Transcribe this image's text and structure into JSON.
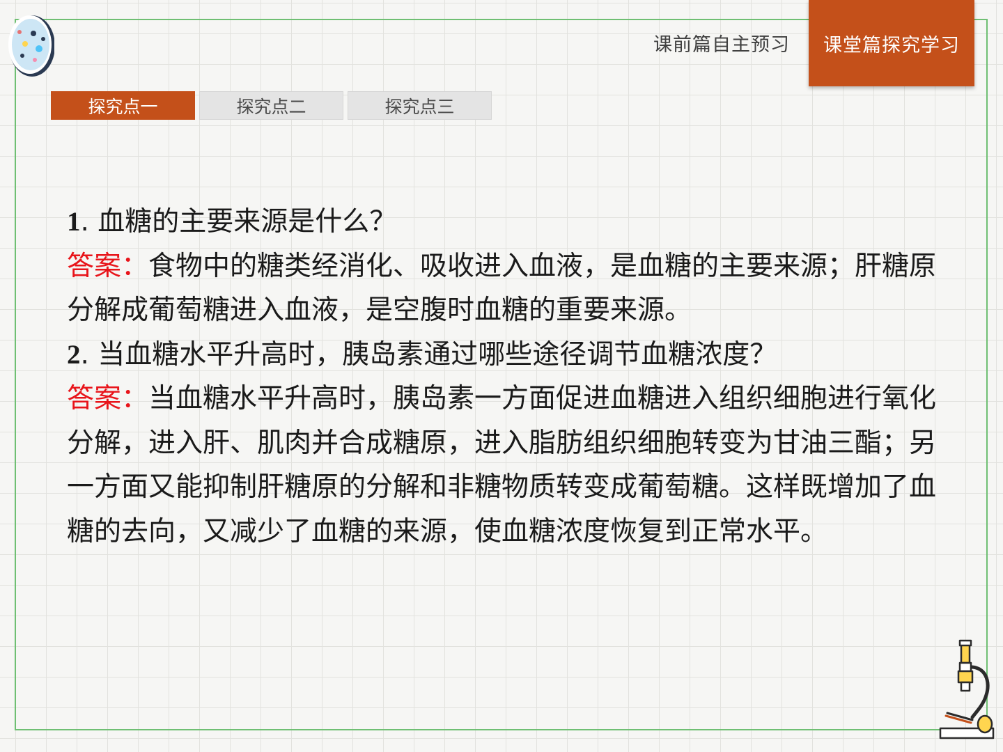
{
  "header": {
    "tabs": [
      {
        "label": "课前篇自主预习"
      },
      {
        "label": "课堂篇探究学习"
      }
    ]
  },
  "subtabs": [
    {
      "label": "探究点一"
    },
    {
      "label": "探究点二"
    },
    {
      "label": "探究点三"
    }
  ],
  "qa": [
    {
      "number": "1",
      "question": ". 血糖的主要来源是什么？",
      "answer_label": "答案：",
      "answer": "食物中的糖类经消化、吸收进入血液，是血糖的主要来源；肝糖原分解成葡萄糖进入血液，是空腹时血糖的重要来源。"
    },
    {
      "number": "2",
      "question": ". 当血糖水平升高时，胰岛素通过哪些途径调节血糖浓度？",
      "answer_label": "答案：",
      "answer": "当血糖水平升高时，胰岛素一方面促进血糖进入组织细胞进行氧化分解，进入肝、肌肉并合成糖原，进入脂肪组织细胞转变为甘油三酯；另一方面又能抑制肝糖原的分解和非糖物质转变成葡萄糖。这样既增加了血糖的去向，又减少了血糖的来源，使血糖浓度恢复到正常水平。"
    }
  ],
  "colors": {
    "accent": "#c4501a",
    "answer_label": "#e8141a",
    "frame": "#6fbf73"
  }
}
